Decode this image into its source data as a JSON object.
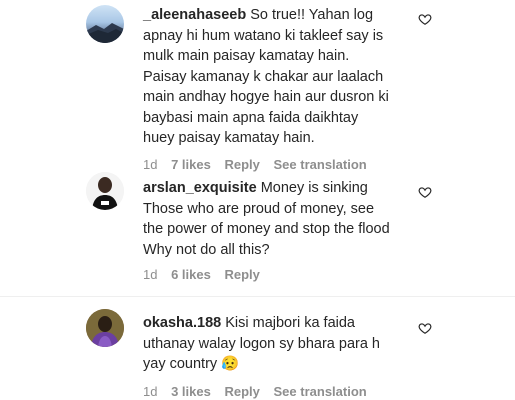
{
  "comments": [
    {
      "username": "_aleenahaseeb",
      "text": "So true!! Yahan log apnay hi hum watano ki takleef say is mulk main paisay kamatay hain. Paisay kamanay k chakar aur laalach main andhay hogye hain aur dusron ki baybasi main apna faida daikhtay huey paisay kamatay hain.",
      "time": "1d",
      "likes": "7 likes",
      "reply": "Reply",
      "translation": "See translation"
    },
    {
      "username": "arslan_exquisite",
      "text": "Money is sinking Those who are proud of money, see the power of money and stop the flood Why not do all this?",
      "time": "1d",
      "likes": "6 likes",
      "reply": "Reply"
    },
    {
      "username": "okasha.188",
      "text": "Kisi majbori ka faida uthanay walay logon sy bhara para h yay country 😥",
      "time": "1d",
      "likes": "3 likes",
      "reply": "Reply",
      "translation": "See translation"
    }
  ],
  "icons": {
    "like": "heart-icon"
  }
}
